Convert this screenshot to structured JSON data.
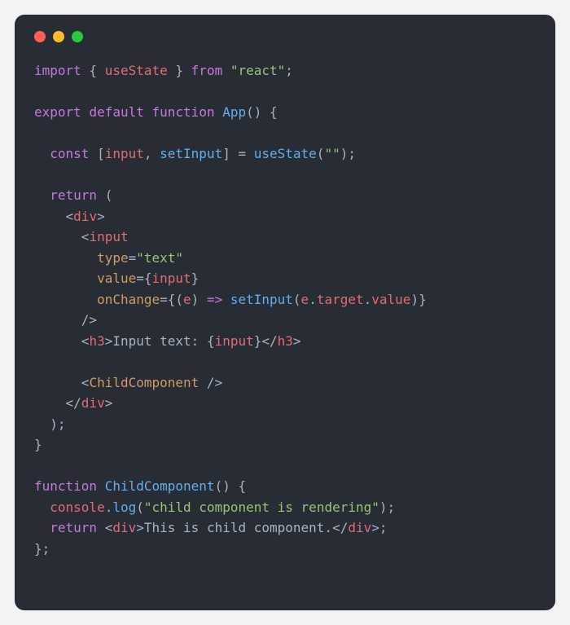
{
  "window": {
    "traffic_lights": [
      "close",
      "minimize",
      "zoom"
    ]
  },
  "code": {
    "l1": {
      "a": "import",
      "b": " { ",
      "c": "useState",
      "d": " } ",
      "e": "from",
      "f": " ",
      "g": "\"react\"",
      "h": ";"
    },
    "l2": "",
    "l3": {
      "a": "export",
      "b": " ",
      "c": "default",
      "d": " ",
      "e": "function",
      "f": " ",
      "g": "App",
      "h": "() {"
    },
    "l4": "",
    "l5": {
      "a": "  ",
      "b": "const",
      "c": " [",
      "d": "input",
      "e": ", ",
      "f": "setInput",
      "g": "] = ",
      "h": "useState",
      "i": "(",
      "j": "\"\"",
      "k": ");"
    },
    "l6": "",
    "l7": {
      "a": "  ",
      "b": "return",
      "c": " ("
    },
    "l8": {
      "a": "    <",
      "b": "div",
      "c": ">"
    },
    "l9": {
      "a": "      <",
      "b": "input"
    },
    "l10": {
      "a": "        ",
      "b": "type",
      "c": "=",
      "d": "\"text\""
    },
    "l11": {
      "a": "        ",
      "b": "value",
      "c": "={",
      "d": "input",
      "e": "}"
    },
    "l12": {
      "a": "        ",
      "b": "onChange",
      "c": "={(",
      "d": "e",
      "e": ") ",
      "f": "=>",
      "g": " ",
      "h": "setInput",
      "i": "(",
      "j": "e",
      "k": ".",
      "l": "target",
      "m": ".",
      "n": "value",
      "o": ")}"
    },
    "l13": {
      "a": "      />"
    },
    "l14": {
      "a": "      <",
      "b": "h3",
      "c": ">",
      "d": "Input text: ",
      "e": "{",
      "f": "input",
      "g": "}",
      "h": "</",
      "i": "h3",
      "j": ">"
    },
    "l15": "",
    "l16": {
      "a": "      <",
      "b": "ChildComponent",
      "c": " />"
    },
    "l17": {
      "a": "    </",
      "b": "div",
      "c": ">"
    },
    "l18": {
      "a": "  );"
    },
    "l19": {
      "a": "}"
    },
    "l20": "",
    "l21": {
      "a": "function",
      "b": " ",
      "c": "ChildComponent",
      "d": "() {"
    },
    "l22": {
      "a": "  ",
      "b": "console",
      "c": ".",
      "d": "log",
      "e": "(",
      "f": "\"child component is rendering\"",
      "g": ");"
    },
    "l23": {
      "a": "  ",
      "b": "return",
      "c": " <",
      "d": "div",
      "e": ">",
      "f": "This is child component.",
      "g": "</",
      "h": "div",
      "i": ">;"
    },
    "l24": {
      "a": "};"
    }
  }
}
